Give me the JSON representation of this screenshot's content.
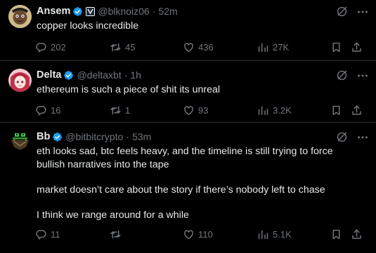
{
  "tweets": [
    {
      "name": "Ansem",
      "handle": "@blknoiz06",
      "time": "52m",
      "text": [
        "copper looks incredible"
      ],
      "replies": "202",
      "reposts": "45",
      "likes": "436",
      "views": "27K",
      "avatar_icon": "cartoon-face-avatar",
      "affiliate_badge": true
    },
    {
      "name": "Delta",
      "handle": "@deltaxbt",
      "time": "1h",
      "text": [
        "ethereum is such a piece of shit its unreal"
      ],
      "replies": "16",
      "reposts": "1",
      "likes": "93",
      "views": "3.2K",
      "avatar_icon": "anime-girl-avatar",
      "affiliate_badge": false
    },
    {
      "name": "Bb",
      "handle": "@bitbitcrypto",
      "time": "53m",
      "text": [
        "eth looks sad, btc feels heavy, and the timeline is still trying to force bullish narratives into the tape",
        "market doesn’t care about the story if there’s nobody left to chase",
        "I think we range around for a while"
      ],
      "replies": "11",
      "reposts": "",
      "likes": "110",
      "views": "5.1K",
      "avatar_icon": "pixel-frog-avatar",
      "affiliate_badge": false
    }
  ],
  "separator": "·",
  "colors": {
    "background": "#000000",
    "text": "#e7e9ea",
    "muted": "#71767b",
    "verified": "#1d9bf0",
    "divider": "#2f3336"
  },
  "icons": {
    "reply": "reply-icon",
    "repost": "repost-icon",
    "like": "like-icon",
    "views": "views-icon",
    "bookmark": "bookmark-icon",
    "share": "share-icon",
    "grok": "grok-icon",
    "more": "more-icon",
    "verified": "verified-badge-icon"
  }
}
